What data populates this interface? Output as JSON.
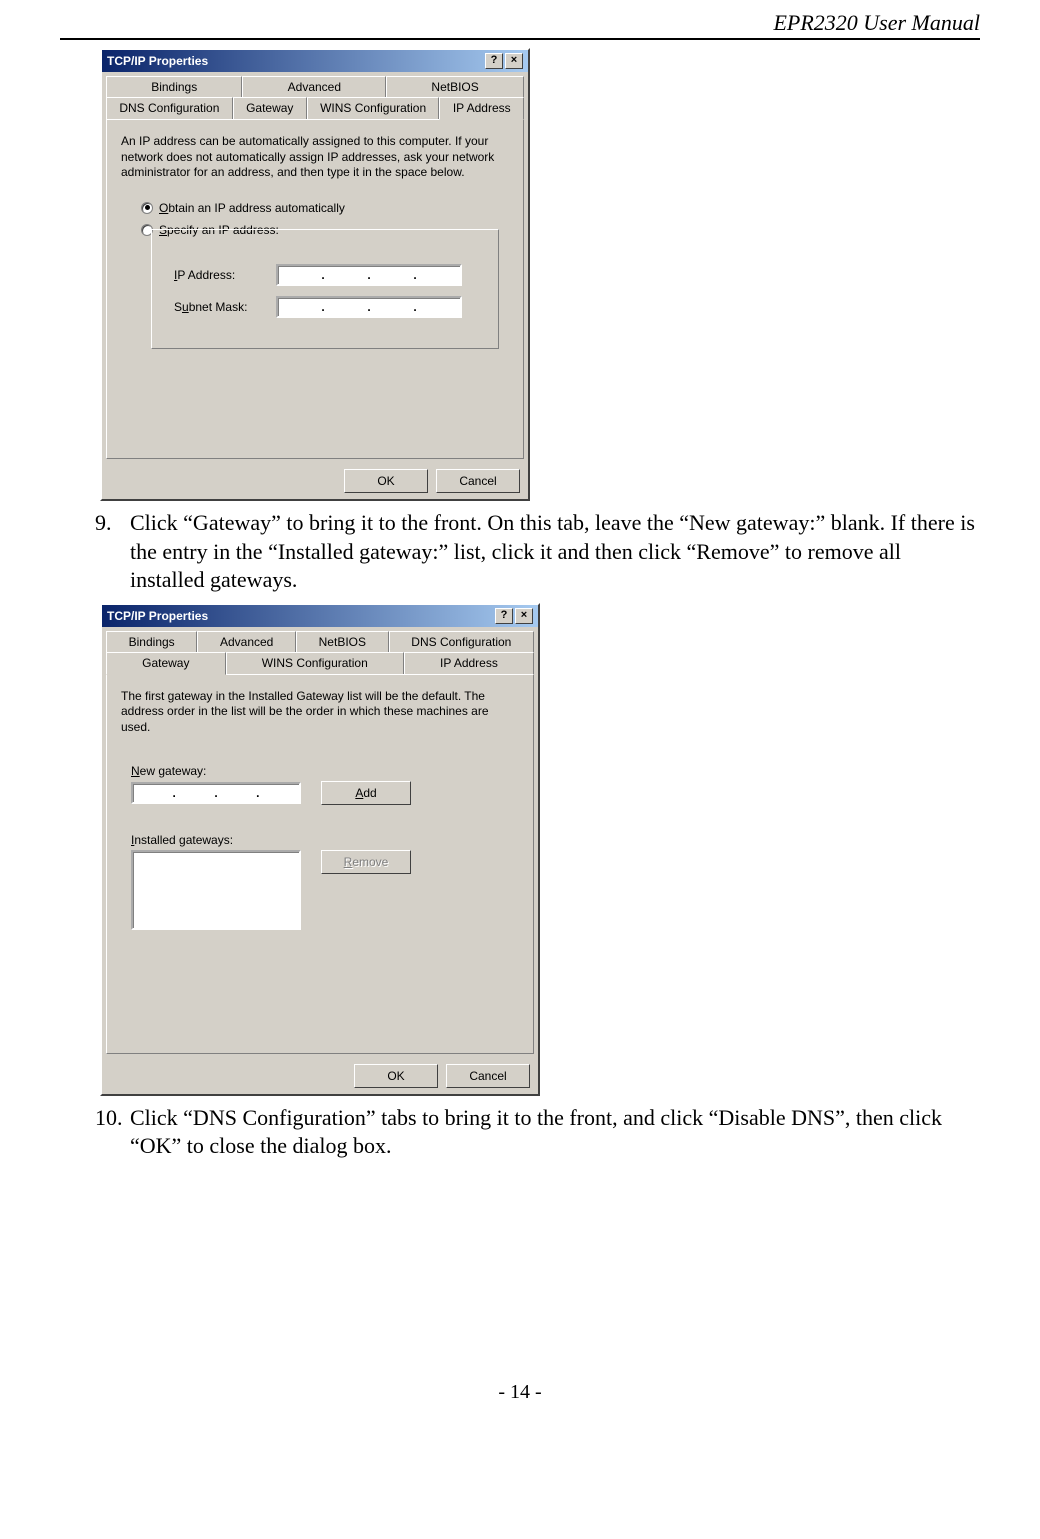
{
  "header": {
    "model": "EPR2320",
    "title_rest": " User Manual"
  },
  "footer": {
    "page": "- 14 -"
  },
  "dlg1": {
    "title": "TCP/IP Properties",
    "help_btn": "?",
    "close_btn": "×",
    "tabs_row1": [
      "Bindings",
      "Advanced",
      "NetBIOS"
    ],
    "tabs_row2": [
      "DNS Configuration",
      "Gateway",
      "WINS Configuration",
      "IP Address"
    ],
    "active_tab": "IP Address",
    "info": "An IP address can be automatically assigned to this computer. If your network does not automatically assign IP addresses, ask your network administrator for an address, and then type it in the space below.",
    "radio_obtain_prefix": "O",
    "radio_obtain_rest": "btain an IP address automatically",
    "radio_specify_prefix": "S",
    "radio_specify_rest": "pecify an IP address:",
    "ip_label_prefix": "I",
    "ip_label_rest": "P Address:",
    "subnet_label_prefix": "u",
    "subnet_label_pre": "S",
    "subnet_label_rest": "bnet Mask:",
    "ok": "OK",
    "cancel": "Cancel"
  },
  "step9": {
    "num": "9.",
    "text": "Click “Gateway” to bring it to the front. On this tab, leave the “New gateway:” blank. If there is the entry in the “Installed gateway:” list, click it and then click “Remove” to remove all installed gateways."
  },
  "dlg2": {
    "title": "TCP/IP Properties",
    "help_btn": "?",
    "close_btn": "×",
    "tabs_row1": [
      "Bindings",
      "Advanced",
      "NetBIOS",
      "DNS Configuration"
    ],
    "tabs_row2": [
      "Gateway",
      "WINS Configuration",
      "IP Address"
    ],
    "active_tab": "Gateway",
    "info": "The first gateway in the Installed Gateway list will be the default. The address order in the list will be the order in which these machines are used.",
    "new_gw_prefix": "N",
    "new_gw_rest": "ew gateway:",
    "add_prefix": "A",
    "add_rest": "dd",
    "installed_prefix": "I",
    "installed_rest": "nstalled gateways:",
    "remove_prefix": "R",
    "remove_rest": "emove",
    "ok": "OK",
    "cancel": "Cancel"
  },
  "step10": {
    "num": "10.",
    "text": "Click “DNS Configuration” tabs to bring it to the front, and click “Disable DNS”, then click “OK” to close the dialog box."
  }
}
